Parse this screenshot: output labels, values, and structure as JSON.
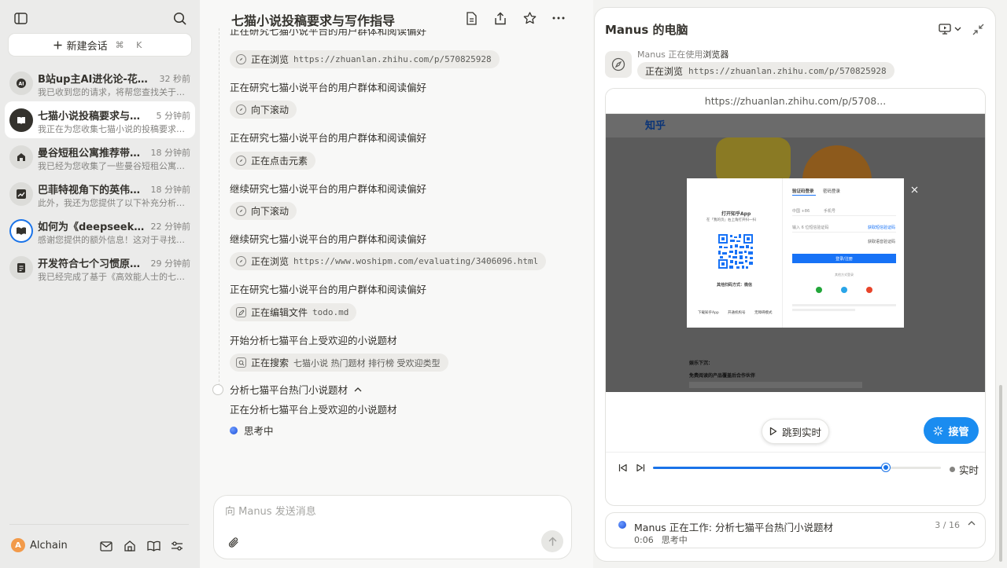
{
  "sidebar": {
    "new_chat_label": "新建会话",
    "shortcut": "⌘ K",
    "conversations": [
      {
        "title": "B站up主AI进化论-花生的...",
        "time": "32 秒前",
        "preview": "我已收到您的请求，将帮您查找关于B站...",
        "icon": "ai-icon"
      },
      {
        "title": "七猫小说投稿要求与写作...",
        "time": "5 分钟前",
        "preview": "我正在为您收集七猫小说的投稿要求信息...",
        "icon": "book-shield-icon"
      },
      {
        "title": "曼谷短租公寓推荐带游泳...",
        "time": "18 分钟前",
        "preview": "我已经为您收集了一些曼谷短租公寓的中...",
        "icon": "building-icon"
      },
      {
        "title": "巴菲特视角下的英伟达股...",
        "time": "18 分钟前",
        "preview": "此外，我还为您提供了以下补充分析文件...",
        "icon": "chart-icon"
      },
      {
        "title": "如何为《deepseek极简...",
        "time": "22 分钟前",
        "preview": "感谢您提供的额外信息！这对于寻找合适...",
        "icon": "book-open-icon"
      },
      {
        "title": "开发符合七个习惯原则的i...",
        "time": "29 分钟前",
        "preview": "我已经完成了基于《高效能人士的七个习...",
        "icon": "checklist-icon"
      }
    ],
    "user": {
      "initial": "A",
      "name": "Alchain"
    }
  },
  "main": {
    "title": "七猫小说投稿要求与写作指导",
    "steps": [
      {
        "type": "chip",
        "action": "正在浏览",
        "detail": "https://zhuanlan.zhihu.com/p/570825928",
        "icon": "browser-icon"
      },
      {
        "type": "text",
        "text": "正在研究七猫小说平台的用户群体和阅读偏好"
      },
      {
        "type": "chip",
        "action": "向下滚动",
        "detail": "",
        "icon": "browser-icon"
      },
      {
        "type": "text",
        "text": "正在研究七猫小说平台的用户群体和阅读偏好"
      },
      {
        "type": "chip",
        "action": "正在点击元素",
        "detail": "",
        "icon": "browser-icon"
      },
      {
        "type": "text",
        "text": "继续研究七猫小说平台的用户群体和阅读偏好"
      },
      {
        "type": "chip",
        "action": "向下滚动",
        "detail": "",
        "icon": "browser-icon"
      },
      {
        "type": "text",
        "text": "继续研究七猫小说平台的用户群体和阅读偏好"
      },
      {
        "type": "chip",
        "action": "正在浏览",
        "detail": "https://www.woshipm.com/evaluating/3406096.html",
        "icon": "browser-icon"
      },
      {
        "type": "text",
        "text": "正在研究七猫小说平台的用户群体和阅读偏好"
      },
      {
        "type": "chip",
        "action": "正在编辑文件",
        "detail": "todo.md",
        "icon": "edit-icon"
      },
      {
        "type": "text",
        "text": "开始分析七猫平台上受欢迎的小说题材"
      },
      {
        "type": "chip",
        "action": "正在搜索",
        "detail": "七猫小说 热门题材 排行榜 受欢迎类型",
        "icon": "search-icon"
      }
    ],
    "top_clipped": "正在研究七猫小说平台的用户群体和阅读偏好",
    "task_title": "分析七猫平台热门小说题材",
    "task_desc": "正在分析七猫平台上受欢迎的小说题材",
    "thinking": "思考中",
    "composer_placeholder": "向 Manus 发送消息"
  },
  "panel": {
    "title": "Manus 的电脑",
    "status_prefix": "Manus 正在使用",
    "status_tool": "浏览器",
    "chip_action": "正在浏览",
    "chip_url": "https://zhuanlan.zhihu.com/p/570825928",
    "url_bar": "https://zhuanlan.zhihu.com/p/5708...",
    "page": {
      "logo": "知乎",
      "tab_code_login": "验证码登录",
      "tab_password_login": "密码登录",
      "open_app": "打开知乎App",
      "scan_hint": "在「我的页」右上角打开扫一扫",
      "other_scan": "其他扫码方式：微信",
      "phone_prefix": "中国 +86",
      "phone_placeholder": "手机号",
      "code_placeholder": "输入 6 位短信验证码",
      "get_sms": "获取短信验证码",
      "get_voice": "获取语音验证码",
      "login_btn": "登录/注册",
      "other_login": "其他方式登录",
      "footer_links": [
        "下载知乎App",
        "开通机构号",
        "无障碍模式"
      ],
      "body_heading": "娱乐下沉：",
      "body_text": "免费阅读的产品覆盖后合作伙伴"
    },
    "jump_label": "跳到实时",
    "takeover_label": "接管",
    "live_label": "实时",
    "progress": 0.81,
    "task_status": "Manus 正在工作: 分析七猫平台热门小说题材",
    "task_time": "0:06",
    "task_thinking": "思考中",
    "task_count": "3 / 16"
  }
}
